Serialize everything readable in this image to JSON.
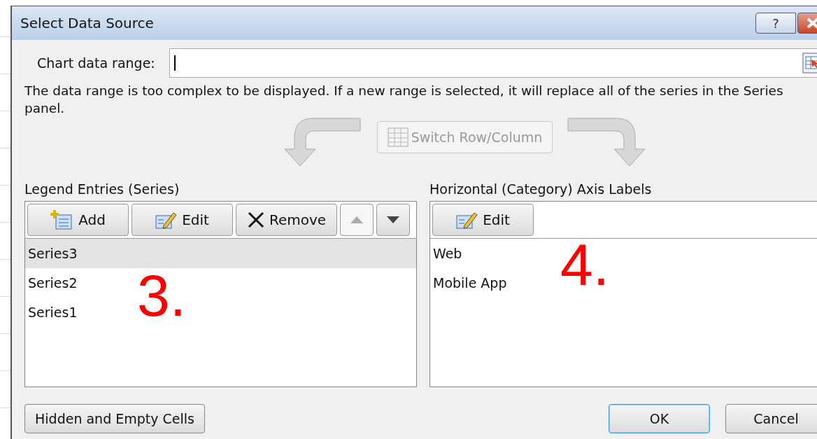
{
  "window": {
    "title": "Select Data Source",
    "help_button": "?"
  },
  "chart_data_range": {
    "label": "Chart data range:",
    "focused": true
  },
  "message": "The data range is too complex to be displayed. If a new range is selected, it will replace all of the series in the Series panel.",
  "switch_button": {
    "label": "Switch Row/Column",
    "disabled": true
  },
  "legend_entries": {
    "label": "Legend Entries (Series)",
    "annotation": "3.",
    "toolbar": [
      {
        "kind": "add",
        "label": "Add",
        "disabled": false
      },
      {
        "kind": "edit",
        "label": "Edit",
        "disabled": false
      },
      {
        "kind": "remove",
        "label": "Remove",
        "disabled": false
      },
      {
        "kind": "up",
        "disabled": true
      },
      {
        "kind": "down",
        "disabled": false
      }
    ],
    "items": [
      {
        "label": "Series3",
        "selected": true
      },
      {
        "label": "Series2",
        "selected": false
      },
      {
        "label": "Series1",
        "selected": false
      }
    ]
  },
  "axis_labels": {
    "label": "Horizontal (Category) Axis Labels",
    "annotation": "4.",
    "edit_button": "Edit",
    "items": [
      {
        "label": "Web",
        "selected": false
      },
      {
        "label": "Mobile App",
        "selected": false
      }
    ]
  },
  "buttons": [
    {
      "kind": "hidden",
      "label": "Hidden and Empty Cells",
      "default": false
    },
    {
      "kind": "ok",
      "label": "OK",
      "default": true
    },
    {
      "kind": "cancel",
      "label": "Cancel",
      "default": false
    }
  ]
}
